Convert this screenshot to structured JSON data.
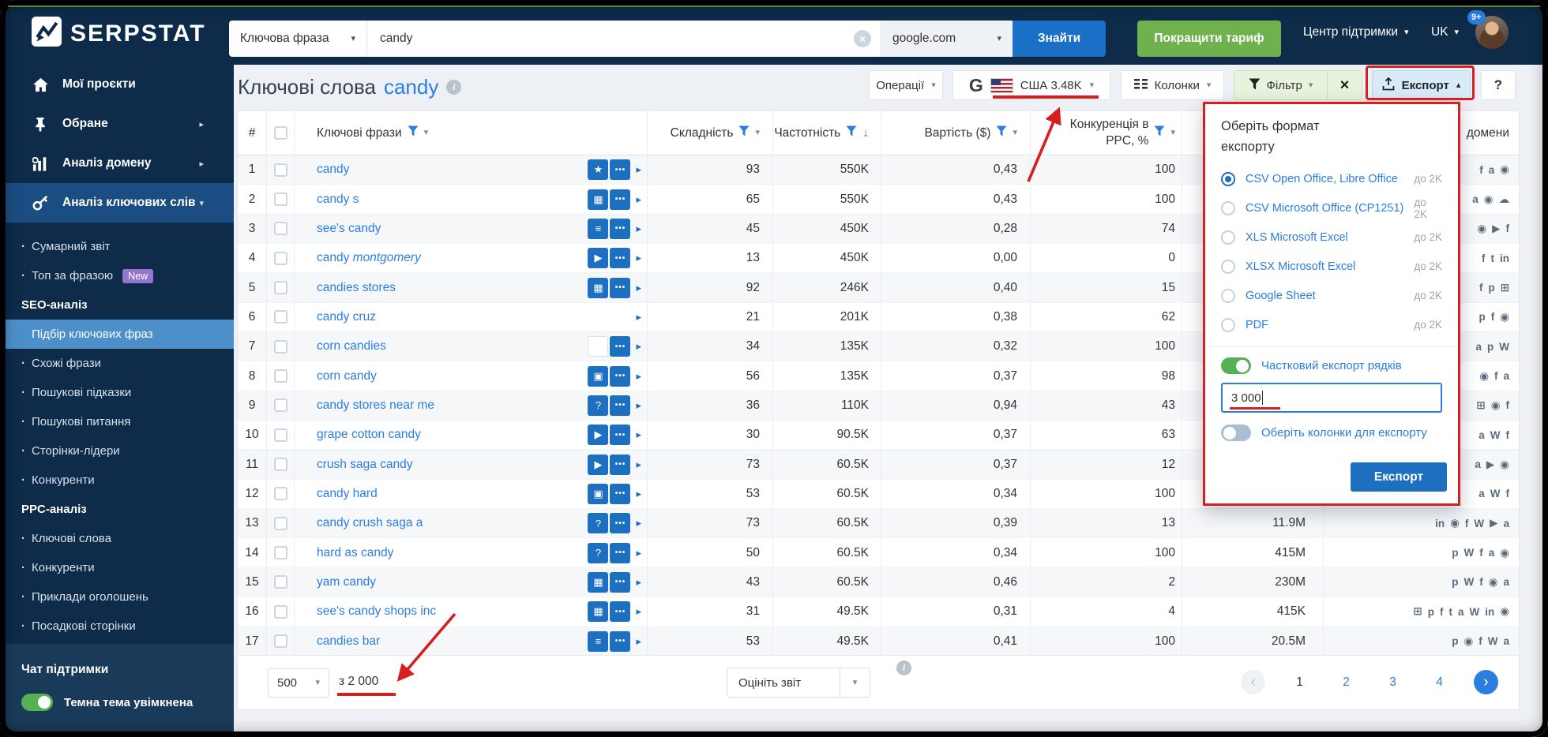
{
  "colors": {
    "navy": "#0e2b4a",
    "accent_blue": "#2b7de0",
    "button_blue": "#1a70c7",
    "green": "#6fb14c",
    "toggle_green": "#56b054",
    "annotation_red": "#d61f1f",
    "active_menu": "#1c4d82",
    "active_submenu": "#4d8fc9",
    "badge_purple": "#9575cd"
  },
  "glyphs": {
    "caret_down": "▾",
    "caret_up": "▴",
    "caret_right": "▸",
    "sort_down": "↓",
    "more": "•••",
    "close": "×",
    "clear": "×",
    "help": "?",
    "info": "i",
    "google": "G",
    "prev": "‹",
    "next": "›"
  },
  "icon_glyphs": {
    "star": "★",
    "images": "▦",
    "list": "≡",
    "video": "▶",
    "chat": "▣",
    "question": "?",
    "blank": "",
    "more": "•••"
  },
  "domain_glyphs": {
    "facebook": "f",
    "amazon": "a",
    "instagram": "◉",
    "youtube": "▶",
    "wikipedia": "W",
    "twitter": "t",
    "linkedin": "in",
    "pinterest": "p",
    "share": "⊞",
    "cloud": "☁"
  },
  "topbar": {
    "brand": "SERPSTAT",
    "search_type": "Ключова фраза",
    "search_query": "candy",
    "search_engine": "google.com",
    "find_button": "Знайти",
    "upgrade_button": "Покращити тариф",
    "support_menu": "Центр підтримки",
    "language": "UK",
    "notifications_badge": "9+"
  },
  "sidebar": {
    "main_items": [
      {
        "label": "Мої проєкти",
        "icon": "home-icon",
        "chevron": "",
        "active": false
      },
      {
        "label": "Обране",
        "icon": "pin-icon",
        "chevron": "right",
        "active": false
      },
      {
        "label": "Аналіз домену",
        "icon": "domain-analysis-icon",
        "chevron": "right",
        "active": false
      },
      {
        "label": "Аналіз ключових слів",
        "icon": "keyword-analysis-icon",
        "chevron": "down",
        "active": true
      }
    ],
    "submenu": [
      {
        "type": "item",
        "label": "Сумарний звіт"
      },
      {
        "type": "item",
        "label": "Топ за фразою",
        "badge": "New"
      },
      {
        "type": "header",
        "label": "SEO-аналіз"
      },
      {
        "type": "item",
        "label": "Підбір ключових фраз",
        "active": true
      },
      {
        "type": "item",
        "label": "Схожі фрази"
      },
      {
        "type": "item",
        "label": "Пошукові підказки"
      },
      {
        "type": "item",
        "label": "Пошукові питання"
      },
      {
        "type": "item",
        "label": "Сторінки-лідери"
      },
      {
        "type": "item",
        "label": "Конкуренти"
      },
      {
        "type": "header",
        "label": "PPC-аналіз"
      },
      {
        "type": "item",
        "label": "Ключові слова"
      },
      {
        "type": "item",
        "label": "Конкуренти"
      },
      {
        "type": "item",
        "label": "Приклади оголошень"
      },
      {
        "type": "item",
        "label": "Посадкові сторінки"
      }
    ],
    "chat_label": "Чат підтримки",
    "theme_toggle_label": "Темна тема увімкнена",
    "theme_toggle_on": true
  },
  "page": {
    "title": "Ключові слова",
    "keyword": "candy"
  },
  "toolbar": {
    "operations": "Операції",
    "region": "США 3.48K",
    "columns": "Колонки",
    "filter": "Фільтр",
    "export": "Експорт"
  },
  "table": {
    "headers": {
      "num": "#",
      "phrases": "Ключові фрази",
      "difficulty": "Складність",
      "volume": "Частотність",
      "cost": "Вартість ($)",
      "ppc": "Конкуренція в PPC, %",
      "domains": "домени"
    },
    "rows": [
      {
        "n": 1,
        "phrase": "candy",
        "icons": [
          "star",
          "more"
        ],
        "diff": 93,
        "vol": "550K",
        "cost": "0,43",
        "ppc": 100,
        "results": "",
        "domains": [
          "facebook",
          "amazon",
          "instagram"
        ]
      },
      {
        "n": 2,
        "phrase": "candy s",
        "icons": [
          "images",
          "more"
        ],
        "diff": 65,
        "vol": "550K",
        "cost": "0,43",
        "ppc": 100,
        "results": "",
        "domains": [
          "amazon",
          "instagram",
          "cloud"
        ]
      },
      {
        "n": 3,
        "phrase": "see's candy",
        "icons": [
          "list",
          "more"
        ],
        "diff": 45,
        "vol": "450K",
        "cost": "0,28",
        "ppc": 74,
        "results": "",
        "domains": [
          "instagram",
          "youtube",
          "facebook"
        ]
      },
      {
        "n": 4,
        "phrase": "candy",
        "italic": "montgomery",
        "icons": [
          "video",
          "more"
        ],
        "diff": 13,
        "vol": "450K",
        "cost": "0,00",
        "ppc": 0,
        "results": "",
        "domains": [
          "facebook",
          "twitter",
          "linkedin"
        ]
      },
      {
        "n": 5,
        "phrase": "candies stores",
        "icons": [
          "images",
          "more"
        ],
        "diff": 92,
        "vol": "246K",
        "cost": "0,40",
        "ppc": 15,
        "results": "",
        "domains": [
          "facebook",
          "pinterest",
          "share"
        ]
      },
      {
        "n": 6,
        "phrase": "candy cruz",
        "icons": [],
        "diff": 21,
        "vol": "201K",
        "cost": "0,38",
        "ppc": 62,
        "results": "",
        "domains": [
          "pinterest",
          "facebook",
          "instagram"
        ]
      },
      {
        "n": 7,
        "phrase": "corn candies",
        "icons": [
          "blank",
          "more"
        ],
        "diff": 34,
        "vol": "135K",
        "cost": "0,32",
        "ppc": 100,
        "results": "",
        "domains": [
          "amazon",
          "pinterest",
          "wikipedia"
        ]
      },
      {
        "n": 8,
        "phrase": "corn candy",
        "icons": [
          "chat",
          "more"
        ],
        "diff": 56,
        "vol": "135K",
        "cost": "0,37",
        "ppc": 98,
        "results": "",
        "domains": [
          "instagram",
          "facebook",
          "amazon"
        ]
      },
      {
        "n": 9,
        "phrase": "candy stores near me",
        "icons": [
          "question",
          "more"
        ],
        "diff": 36,
        "vol": "110K",
        "cost": "0,94",
        "ppc": 43,
        "results": "",
        "domains": [
          "share",
          "instagram",
          "facebook"
        ]
      },
      {
        "n": 10,
        "phrase": "grape cotton candy",
        "icons": [
          "video",
          "more"
        ],
        "diff": 30,
        "vol": "90.5K",
        "cost": "0,37",
        "ppc": 63,
        "results": "",
        "domains": [
          "amazon",
          "wikipedia",
          "facebook"
        ]
      },
      {
        "n": 11,
        "phrase": "crush saga candy",
        "icons": [
          "video",
          "more"
        ],
        "diff": 73,
        "vol": "60.5K",
        "cost": "0,37",
        "ppc": 12,
        "results": "",
        "domains": [
          "amazon",
          "youtube",
          "instagram"
        ]
      },
      {
        "n": 12,
        "phrase": "candy hard",
        "icons": [
          "chat",
          "more"
        ],
        "diff": 53,
        "vol": "60.5K",
        "cost": "0,34",
        "ppc": 100,
        "results": "",
        "domains": [
          "amazon",
          "wikipedia",
          "facebook"
        ]
      },
      {
        "n": 13,
        "phrase": "candy crush saga a",
        "icons": [
          "question",
          "more"
        ],
        "diff": 73,
        "vol": "60.5K",
        "cost": "0,39",
        "ppc": 13,
        "results": "11.9M",
        "domains": [
          "linkedin",
          "instagram",
          "facebook",
          "wikipedia",
          "youtube",
          "amazon"
        ]
      },
      {
        "n": 14,
        "phrase": "hard as candy",
        "icons": [
          "question",
          "more"
        ],
        "diff": 50,
        "vol": "60.5K",
        "cost": "0,34",
        "ppc": 100,
        "results": "415M",
        "domains": [
          "pinterest",
          "wikipedia",
          "facebook",
          "amazon",
          "instagram"
        ]
      },
      {
        "n": 15,
        "phrase": "yam candy",
        "icons": [
          "images",
          "more"
        ],
        "diff": 43,
        "vol": "60.5K",
        "cost": "0,46",
        "ppc": 2,
        "results": "230M",
        "domains": [
          "pinterest",
          "wikipedia",
          "facebook",
          "instagram",
          "amazon"
        ]
      },
      {
        "n": 16,
        "phrase": "see's candy shops inc",
        "icons": [
          "images",
          "more"
        ],
        "diff": 31,
        "vol": "49.5K",
        "cost": "0,31",
        "ppc": 4,
        "results": "415K",
        "domains": [
          "share",
          "pinterest",
          "facebook",
          "twitter",
          "amazon",
          "wikipedia",
          "linkedin",
          "instagram"
        ]
      },
      {
        "n": 17,
        "phrase": "candies bar",
        "icons": [
          "list",
          "more"
        ],
        "diff": 53,
        "vol": "49.5K",
        "cost": "0,41",
        "ppc": 100,
        "results": "20.5M",
        "domains": [
          "pinterest",
          "instagram",
          "facebook",
          "wikipedia",
          "amazon"
        ]
      }
    ]
  },
  "export_panel": {
    "title": "Оберіть формат експорту",
    "formats": [
      {
        "label": "CSV Open Office, Libre Office",
        "limit": "до 2K",
        "selected": true
      },
      {
        "label": "CSV Microsoft Office (CP1251)",
        "limit": "до 2K",
        "selected": false
      },
      {
        "label": "XLS Microsoft Excel",
        "limit": "до 2K",
        "selected": false
      },
      {
        "label": "XLSX Microsoft Excel",
        "limit": "до 2K",
        "selected": false
      },
      {
        "label": "Google Sheet",
        "limit": "до 2K",
        "selected": false
      },
      {
        "label": "PDF",
        "limit": "до 2K",
        "selected": false
      }
    ],
    "partial_export_label": "Частковий експорт рядків",
    "partial_export_on": true,
    "rows_value": "3 000",
    "columns_toggle_label": "Оберіть колонки для експорту",
    "columns_toggle_on": false,
    "submit": "Експорт"
  },
  "footer": {
    "page_size": "500",
    "total": "з 2 000",
    "rate_label": "Оцініть звіт",
    "pages": [
      "1",
      "2",
      "3",
      "4"
    ],
    "current_page": "1"
  }
}
